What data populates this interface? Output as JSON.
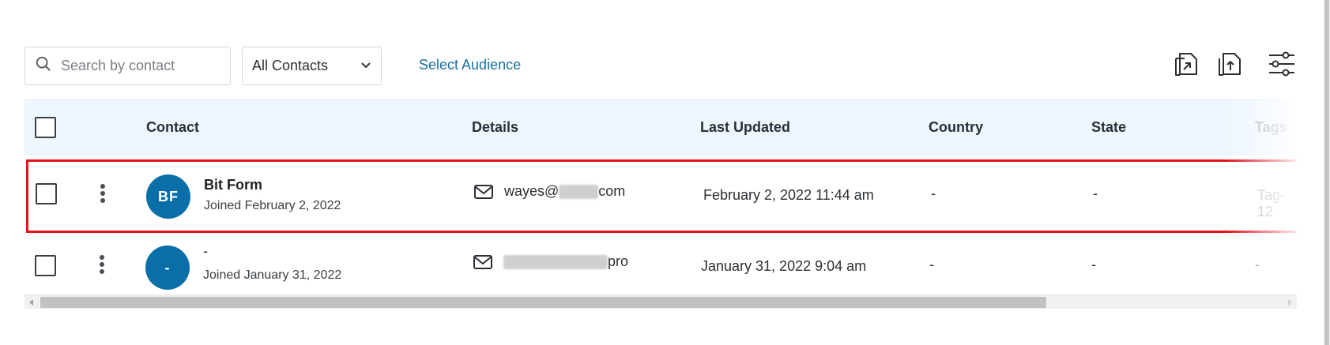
{
  "toolbar": {
    "search_placeholder": "Search by contact",
    "filter_selected": "All Contacts",
    "select_audience_label": "Select Audience",
    "icons": [
      "import-icon",
      "export-icon",
      "column-settings-icon"
    ]
  },
  "table": {
    "columns": [
      "Contact",
      "Details",
      "Last Updated",
      "Country",
      "State",
      "Tags"
    ],
    "rows": [
      {
        "initials": "BF",
        "name": "Bit Form",
        "joined": "Joined February 2, 2022",
        "email_prefix": "wayes@",
        "email_suffix": "com",
        "last_updated": "February 2, 2022 11:44 am",
        "country": "-",
        "state": "-",
        "tags": "Tag-12"
      },
      {
        "initials": "-",
        "name": "-",
        "joined": "Joined January 31, 2022",
        "email_prefix": "",
        "email_suffix": "pro",
        "last_updated": "January 31, 2022 9:04 am",
        "country": "-",
        "state": "-",
        "tags": "-"
      }
    ]
  },
  "colors": {
    "accent": "#1a6fa3",
    "avatar": "#0a6ea8",
    "header_bg": "#eef6ff",
    "highlight": "#e3141e"
  }
}
